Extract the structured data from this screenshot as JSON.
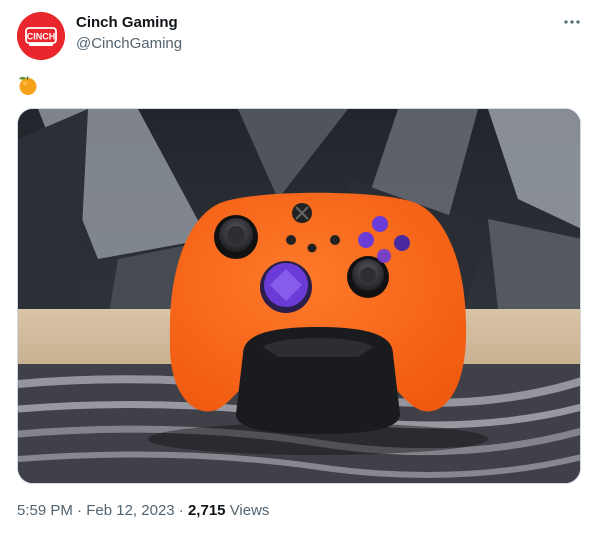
{
  "tweet": {
    "author": {
      "display_name": "Cinch Gaming",
      "handle": "@CinchGaming",
      "avatar_text": "CINCH"
    },
    "body_emoji": "🍊",
    "media_description_icon": "controller-photo",
    "timestamp": {
      "time": "5:59 PM",
      "separator": "·",
      "date": "Feb 12, 2023",
      "separator2": "·",
      "views_count": "2,715",
      "views_label": "Views"
    }
  },
  "colors": {
    "brand_red": "#e8262b",
    "controller_orange": "#ff6a1a",
    "accent_purple": "#6a3bd6",
    "secondary_text": "#536471"
  }
}
